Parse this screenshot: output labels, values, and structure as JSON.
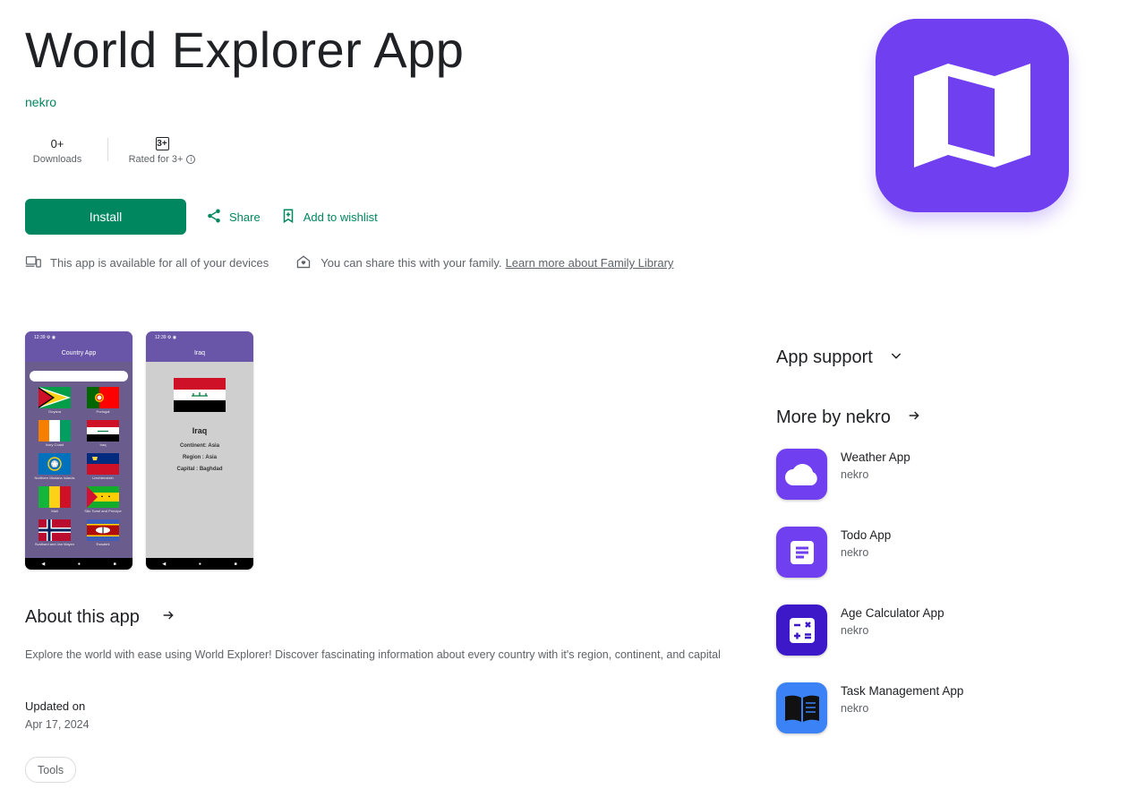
{
  "app": {
    "title": "World Explorer App",
    "developer": "nekro"
  },
  "stats": {
    "downloads_value": "0+",
    "downloads_label": "Downloads",
    "rating_badge": "3+",
    "rating_label": "Rated for 3+",
    "info_glyph": "i"
  },
  "actions": {
    "install_label": "Install",
    "share_label": "Share",
    "wishlist_label": "Add to wishlist"
  },
  "availability": {
    "devices_text": "This app is available for all of your devices",
    "family_text": "You can share this with your family.",
    "family_link": "Learn more about Family Library"
  },
  "screenshots": {
    "shot1": {
      "status": "12:39 ⚙ ◉",
      "title": "Country App",
      "flags": [
        "Guyana",
        "Portugal",
        "Ivory Coast",
        "Iraq",
        "Northern Mariana Islands",
        "Liechtenstein",
        "Mali",
        "São Tomé and Príncipe",
        "Svalbard and Jan Mayen",
        "Eswatini"
      ]
    },
    "shot2": {
      "status": "12:39 ⚙ ◉",
      "title": "Iraq",
      "country": "Iraq",
      "continent": "Continent: Asia",
      "region": "Region : Asia",
      "capital": "Capital : Baghdad"
    },
    "navbar": [
      "◀",
      "●",
      "■"
    ]
  },
  "about": {
    "heading": "About this app",
    "description": "Explore the world with ease using World Explorer! Discover fascinating information about every country with it's region, continent, and capital",
    "updated_label": "Updated on",
    "updated_value": "Apr 17, 2024",
    "tag": "Tools"
  },
  "sidebar": {
    "support_heading": "App support",
    "more_heading": "More by nekro",
    "more_apps": [
      {
        "name": "Weather App",
        "developer": "nekro",
        "icon": "cloud-icon",
        "color": "#6f3ff0"
      },
      {
        "name": "Todo App",
        "developer": "nekro",
        "icon": "document-icon",
        "color": "#6f3ff0"
      },
      {
        "name": "Age Calculator App",
        "developer": "nekro",
        "icon": "calculator-icon",
        "color": "#3d18c9"
      },
      {
        "name": "Task Management App",
        "developer": "nekro",
        "icon": "book-icon",
        "color": "#3b82f6"
      }
    ]
  },
  "colors": {
    "accent": "#01875f",
    "brand_purple": "#6f3ff0"
  }
}
